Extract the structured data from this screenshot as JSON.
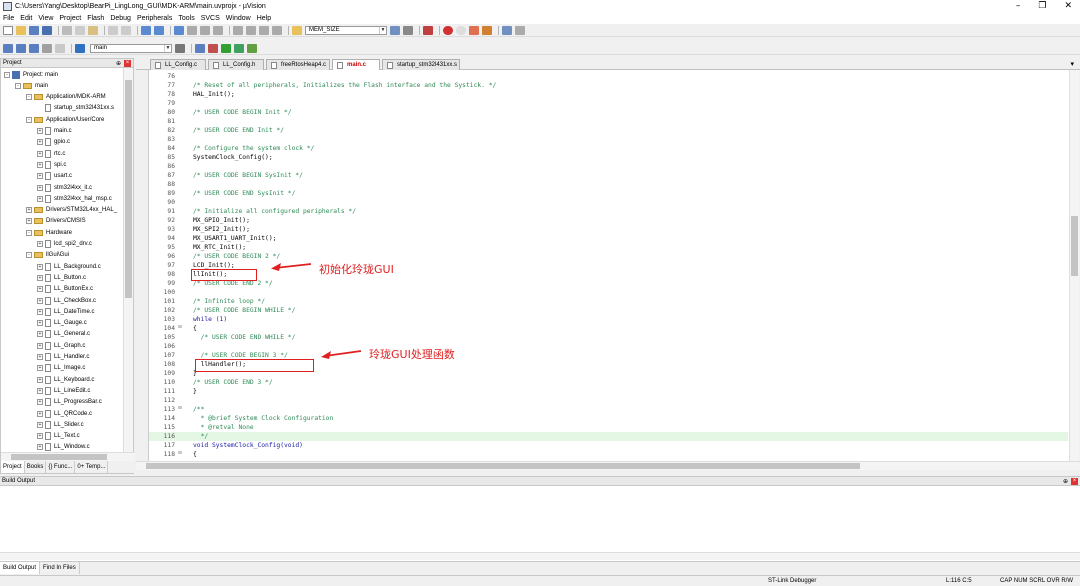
{
  "window": {
    "title": "C:\\Users\\Yang\\Desktop\\BearPi_LingLong_GUI\\MDK-ARM\\main.uvprojx - µVision",
    "controls": {
      "minimize": "–",
      "maximize": "❐",
      "close": "✕"
    }
  },
  "menu": [
    "File",
    "Edit",
    "View",
    "Project",
    "Flash",
    "Debug",
    "Peripherals",
    "Tools",
    "SVCS",
    "Window",
    "Help"
  ],
  "toolbar": {
    "search_combo": "MEM_SIZE",
    "target_combo": "main"
  },
  "project_pane": {
    "title": "Project",
    "tree": [
      {
        "label": "Project: main",
        "depth": 0,
        "kind": "project",
        "expand": "-"
      },
      {
        "label": "main",
        "depth": 1,
        "kind": "folder",
        "expand": "-"
      },
      {
        "label": "Application/MDK-ARM",
        "depth": 2,
        "kind": "folder",
        "expand": "-"
      },
      {
        "label": "startup_stm32l431xx.s",
        "depth": 3,
        "kind": "file",
        "expand": ""
      },
      {
        "label": "Application/User/Core",
        "depth": 2,
        "kind": "folder",
        "expand": "-"
      },
      {
        "label": "main.c",
        "depth": 3,
        "kind": "file",
        "expand": "+"
      },
      {
        "label": "gpio.c",
        "depth": 3,
        "kind": "file",
        "expand": "+"
      },
      {
        "label": "rtc.c",
        "depth": 3,
        "kind": "file",
        "expand": "+"
      },
      {
        "label": "spi.c",
        "depth": 3,
        "kind": "file",
        "expand": "+"
      },
      {
        "label": "usart.c",
        "depth": 3,
        "kind": "file",
        "expand": "+"
      },
      {
        "label": "stm32l4xx_it.c",
        "depth": 3,
        "kind": "file",
        "expand": "+"
      },
      {
        "label": "stm32l4xx_hal_msp.c",
        "depth": 3,
        "kind": "file",
        "expand": "+"
      },
      {
        "label": "Drivers/STM32L4xx_HAL_",
        "depth": 2,
        "kind": "folder",
        "expand": "+"
      },
      {
        "label": "Drivers/CMSIS",
        "depth": 2,
        "kind": "folder",
        "expand": "+"
      },
      {
        "label": "Hardware",
        "depth": 2,
        "kind": "folder",
        "expand": "-"
      },
      {
        "label": "lcd_spi2_drv.c",
        "depth": 3,
        "kind": "file",
        "expand": "+"
      },
      {
        "label": "llGui\\Gui",
        "depth": 2,
        "kind": "folder",
        "expand": "-"
      },
      {
        "label": "LL_Background.c",
        "depth": 3,
        "kind": "file",
        "expand": "+"
      },
      {
        "label": "LL_Button.c",
        "depth": 3,
        "kind": "file",
        "expand": "+"
      },
      {
        "label": "LL_ButtonEx.c",
        "depth": 3,
        "kind": "file",
        "expand": "+"
      },
      {
        "label": "LL_CheckBox.c",
        "depth": 3,
        "kind": "file",
        "expand": "+"
      },
      {
        "label": "LL_DateTime.c",
        "depth": 3,
        "kind": "file",
        "expand": "+"
      },
      {
        "label": "LL_Gauge.c",
        "depth": 3,
        "kind": "file",
        "expand": "+"
      },
      {
        "label": "LL_General.c",
        "depth": 3,
        "kind": "file",
        "expand": "+"
      },
      {
        "label": "LL_Graph.c",
        "depth": 3,
        "kind": "file",
        "expand": "+"
      },
      {
        "label": "LL_Handler.c",
        "depth": 3,
        "kind": "file",
        "expand": "+"
      },
      {
        "label": "LL_Image.c",
        "depth": 3,
        "kind": "file",
        "expand": "+"
      },
      {
        "label": "LL_Keyboard.c",
        "depth": 3,
        "kind": "file",
        "expand": "+"
      },
      {
        "label": "LL_LineEdit.c",
        "depth": 3,
        "kind": "file",
        "expand": "+"
      },
      {
        "label": "LL_ProgressBar.c",
        "depth": 3,
        "kind": "file",
        "expand": "+"
      },
      {
        "label": "LL_QRCode.c",
        "depth": 3,
        "kind": "file",
        "expand": "+"
      },
      {
        "label": "LL_Slider.c",
        "depth": 3,
        "kind": "file",
        "expand": "+"
      },
      {
        "label": "LL_Text.c",
        "depth": 3,
        "kind": "file",
        "expand": "+"
      },
      {
        "label": "LL_Window.c",
        "depth": 3,
        "kind": "file",
        "expand": "+"
      }
    ],
    "tabs": [
      "Project",
      "Books",
      "{} Func...",
      "0+ Temp..."
    ]
  },
  "editor_tabs": [
    {
      "label": "LL_Config.c",
      "active": false
    },
    {
      "label": "LL_Config.h",
      "active": false
    },
    {
      "label": "freeRtosHeap4.c",
      "active": false
    },
    {
      "label": "main.c",
      "active": true
    },
    {
      "label": "startup_stm32l431xx.s",
      "active": false
    }
  ],
  "code_lines": [
    {
      "n": "76",
      "f": "",
      "t": "",
      "c": ""
    },
    {
      "n": "77",
      "f": "",
      "t": "/* Reset of all peripherals, Initializes the Flash interface and the Systick. */",
      "c": "cm"
    },
    {
      "n": "78",
      "f": "",
      "t": "HAL_Init();",
      "c": "fn"
    },
    {
      "n": "79",
      "f": "",
      "t": "",
      "c": ""
    },
    {
      "n": "80",
      "f": "",
      "t": "/* USER CODE BEGIN Init */",
      "c": "cm"
    },
    {
      "n": "81",
      "f": "",
      "t": "",
      "c": ""
    },
    {
      "n": "82",
      "f": "",
      "t": "/* USER CODE END Init */",
      "c": "cm"
    },
    {
      "n": "83",
      "f": "",
      "t": "",
      "c": ""
    },
    {
      "n": "84",
      "f": "",
      "t": "/* Configure the system clock */",
      "c": "cm"
    },
    {
      "n": "85",
      "f": "",
      "t": "SystemClock_Config();",
      "c": "fn"
    },
    {
      "n": "86",
      "f": "",
      "t": "",
      "c": ""
    },
    {
      "n": "87",
      "f": "",
      "t": "/* USER CODE BEGIN SysInit */",
      "c": "cm"
    },
    {
      "n": "88",
      "f": "",
      "t": "",
      "c": ""
    },
    {
      "n": "89",
      "f": "",
      "t": "/* USER CODE END SysInit */",
      "c": "cm"
    },
    {
      "n": "90",
      "f": "",
      "t": "",
      "c": ""
    },
    {
      "n": "91",
      "f": "",
      "t": "/* Initialize all configured peripherals */",
      "c": "cm"
    },
    {
      "n": "92",
      "f": "",
      "t": "MX_GPIO_Init();",
      "c": "fn"
    },
    {
      "n": "93",
      "f": "",
      "t": "MX_SPI2_Init();",
      "c": "fn"
    },
    {
      "n": "94",
      "f": "",
      "t": "MX_USART1_UART_Init();",
      "c": "fn"
    },
    {
      "n": "95",
      "f": "",
      "t": "MX_RTC_Init();",
      "c": "fn"
    },
    {
      "n": "96",
      "f": "",
      "t": "/* USER CODE BEGIN 2 */",
      "c": "cm"
    },
    {
      "n": "97",
      "f": "",
      "t": "LCD_Init();",
      "c": "fn"
    },
    {
      "n": "98",
      "f": "",
      "t": "llInit();",
      "c": "fn"
    },
    {
      "n": "99",
      "f": "",
      "t": "/* USER CODE END 2 */",
      "c": "cm"
    },
    {
      "n": "100",
      "f": "",
      "t": "",
      "c": ""
    },
    {
      "n": "101",
      "f": "",
      "t": "/* Infinite loop */",
      "c": "cm"
    },
    {
      "n": "102",
      "f": "",
      "t": "/* USER CODE BEGIN WHILE */",
      "c": "cm"
    },
    {
      "n": "103",
      "f": "",
      "t": "while (1)",
      "c": "kw"
    },
    {
      "n": "104",
      "f": "⊟",
      "t": "{",
      "c": "fn"
    },
    {
      "n": "105",
      "f": "",
      "t": "  /* USER CODE END WHILE */",
      "c": "cm"
    },
    {
      "n": "106",
      "f": "",
      "t": "",
      "c": ""
    },
    {
      "n": "107",
      "f": "",
      "t": "  /* USER CODE BEGIN 3 */",
      "c": "cm"
    },
    {
      "n": "108",
      "f": "",
      "t": "  llHandler();",
      "c": "fn"
    },
    {
      "n": "109",
      "f": "",
      "t": "}",
      "c": "fn"
    },
    {
      "n": "110",
      "f": "",
      "t": "/* USER CODE END 3 */",
      "c": "cm"
    },
    {
      "n": "111",
      "f": "",
      "t": "}",
      "c": "fn"
    },
    {
      "n": "112",
      "f": "",
      "t": "",
      "c": ""
    },
    {
      "n": "113",
      "f": "⊟",
      "t": "/**",
      "c": "cm"
    },
    {
      "n": "114",
      "f": "",
      "t": "  * @brief System Clock Configuration",
      "c": "cm"
    },
    {
      "n": "115",
      "f": "",
      "t": "  * @retval None",
      "c": "cm"
    },
    {
      "n": "116",
      "f": "",
      "t": "  */",
      "c": "cm",
      "hl": true
    },
    {
      "n": "117",
      "f": "",
      "t": "void SystemClock_Config(void)",
      "c": "kw"
    },
    {
      "n": "118",
      "f": "⊟",
      "t": "{",
      "c": "fn"
    }
  ],
  "annotations": {
    "init_label": "初始化玲珑GUI",
    "handler_label": "玲珑GUI处理函数"
  },
  "build_output": {
    "title": "Build Output"
  },
  "bottom_tabs": [
    "Build Output",
    "Find In Files"
  ],
  "status": {
    "debugger": "ST-Link Debugger",
    "position": "L:116 C:5",
    "flags": "CAP NUM SCRL OVR R/W"
  },
  "colors": {
    "annotation": "#e02020",
    "comment": "#2e8b57",
    "keyword": "#1a1aa6",
    "active_tab": "#c00000"
  }
}
